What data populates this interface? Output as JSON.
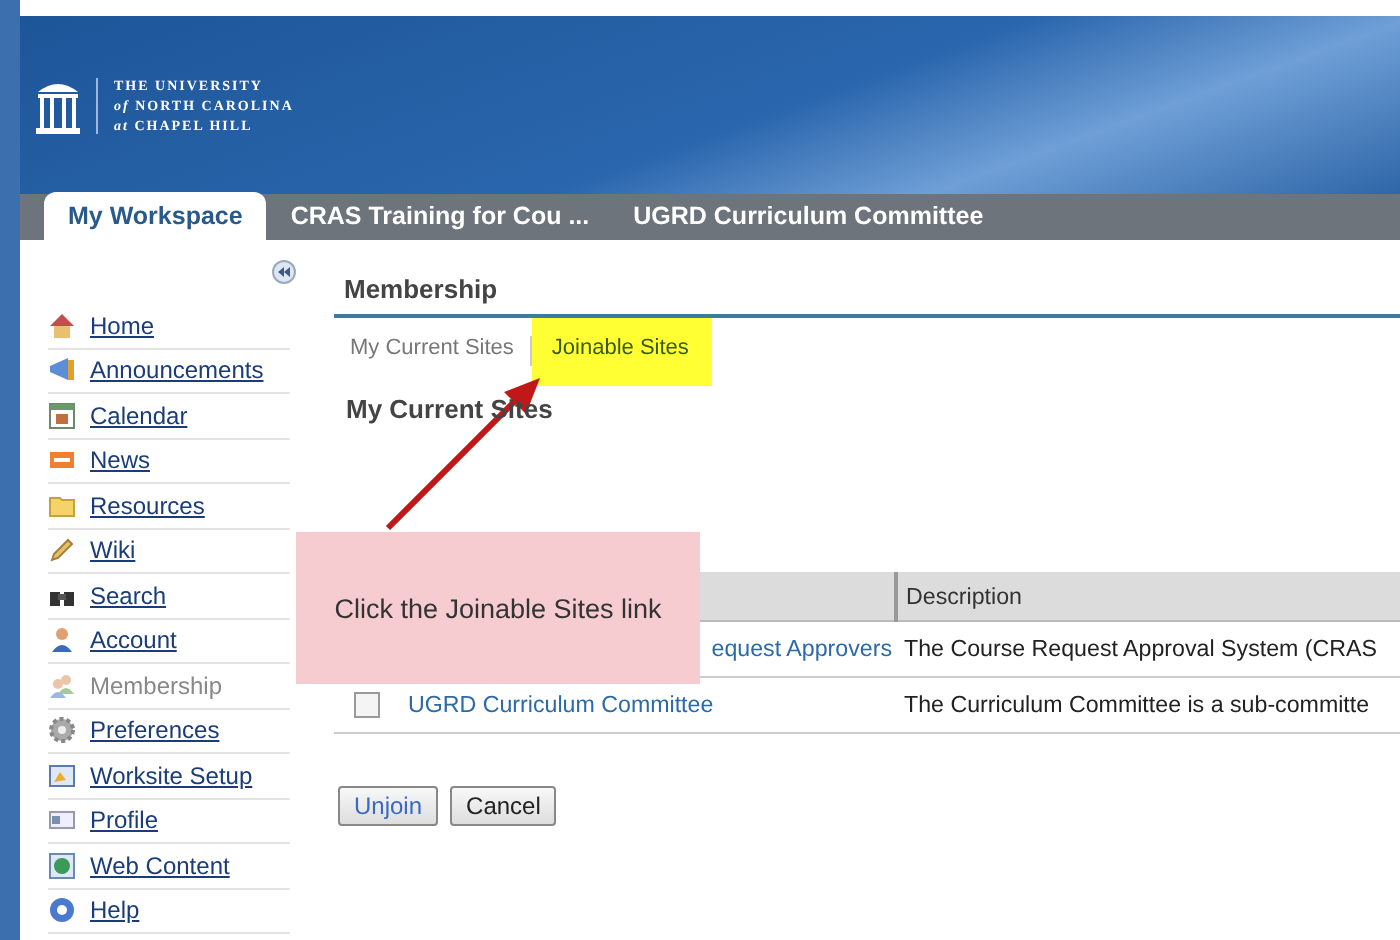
{
  "header": {
    "logo_lines": [
      "THE UNIVERSITY",
      "*of* NORTH CAROLINA",
      "*at* CHAPEL HILL"
    ]
  },
  "site_tabs": [
    {
      "label": "My Workspace",
      "selected": true
    },
    {
      "label": "CRAS Training for Cou ...",
      "selected": false
    },
    {
      "label": "UGRD Curriculum Committee",
      "selected": false
    }
  ],
  "sidebar": {
    "items": [
      {
        "label": "Home",
        "selected": false
      },
      {
        "label": "Announcements",
        "selected": false
      },
      {
        "label": "Calendar",
        "selected": false
      },
      {
        "label": "News",
        "selected": false
      },
      {
        "label": "Resources",
        "selected": false
      },
      {
        "label": "Wiki",
        "selected": false
      },
      {
        "label": "Search",
        "selected": false
      },
      {
        "label": "Account",
        "selected": false
      },
      {
        "label": "Membership",
        "selected": true
      },
      {
        "label": "Preferences",
        "selected": false
      },
      {
        "label": "Worksite Setup",
        "selected": false
      },
      {
        "label": "Profile",
        "selected": false
      },
      {
        "label": "Web Content",
        "selected": false
      },
      {
        "label": "Help",
        "selected": false
      }
    ]
  },
  "tool": {
    "title": "Membership",
    "tabs": [
      {
        "label": "My Current Sites",
        "selected": true,
        "highlighted": false
      },
      {
        "label": "Joinable Sites",
        "selected": false,
        "highlighted": true
      }
    ],
    "heading": "My Current Sites",
    "table": {
      "description_header": "Description",
      "rows": [
        {
          "site": "equest Approvers",
          "description": "The Course Request Approval System (CRAS"
        },
        {
          "checked": false,
          "site": "UGRD Curriculum Committee",
          "description": "The Curriculum Committee is a sub-committe"
        }
      ]
    },
    "buttons": [
      {
        "label": "Unjoin",
        "kind": "primary"
      },
      {
        "label": "Cancel",
        "kind": "normal"
      }
    ]
  },
  "callout": {
    "text": "Click the Joinable Sites link"
  }
}
